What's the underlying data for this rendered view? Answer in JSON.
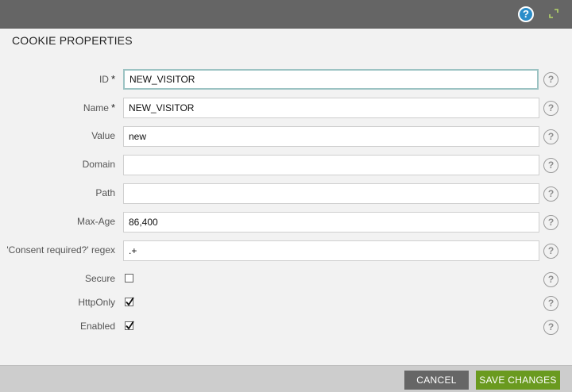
{
  "header": {
    "help_glyph": "?",
    "accent_color": "#2a8dc9",
    "expand_icon": "expand-icon"
  },
  "dialog": {
    "title": "COOKIE PROPERTIES"
  },
  "fields": {
    "id": {
      "label": "ID",
      "required_mark": "*",
      "value": "NEW_VISITOR"
    },
    "name": {
      "label": "Name",
      "required_mark": "*",
      "value": "NEW_VISITOR"
    },
    "value": {
      "label": "Value",
      "value": "new"
    },
    "domain": {
      "label": "Domain",
      "value": ""
    },
    "path": {
      "label": "Path",
      "value": ""
    },
    "max_age": {
      "label": "Max-Age",
      "value": "86,400"
    },
    "consent_regex": {
      "label": "'Consent required?' regex",
      "value": ".+"
    },
    "secure": {
      "label": "Secure",
      "checked": false
    },
    "http_only": {
      "label": "HttpOnly",
      "checked": true
    },
    "enabled": {
      "label": "Enabled",
      "checked": true
    }
  },
  "help_glyph": "?",
  "footer": {
    "cancel_label": "CANCEL",
    "save_label": "SAVE CHANGES",
    "save_color": "#6a9a1f"
  }
}
